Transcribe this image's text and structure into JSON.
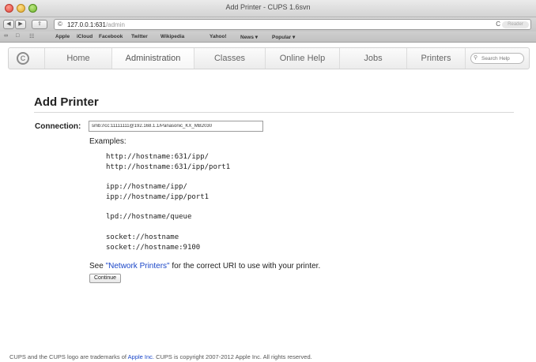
{
  "window": {
    "title": "Add Printer - CUPS 1.6svn"
  },
  "toolbar": {
    "back_icon": "◀",
    "forward_icon": "▶",
    "share_icon": "⇪",
    "url_icon": "©",
    "url_host": "127.0.0.1:631",
    "url_path": "/admin",
    "reload_icon": "C",
    "reader_label": "Reader"
  },
  "bookmarks": {
    "icons": [
      "∞",
      "□",
      "☷"
    ],
    "items": [
      "Apple",
      "iCloud",
      "Facebook",
      "Twitter",
      "Wikipedia",
      "Yahoo!",
      "News ▾",
      "Popular ▾"
    ]
  },
  "nav": {
    "logo": "C",
    "tabs": [
      "Home",
      "Administration",
      "Classes",
      "Online Help",
      "Jobs",
      "Printers"
    ],
    "active_tab": "Administration",
    "search_placeholder": "Search Help",
    "search_icon": "⚲"
  },
  "content": {
    "title": "Add Printer",
    "connection_label": "Connection:",
    "connection_value": "smb://cc:11111111@192.168.1.1/Panasonic_KX_MB2030",
    "examples_label": "Examples:",
    "examples": [
      "http://hostname:631/ipp/",
      "http://hostname:631/ipp/port1",
      "ipp://hostname/ipp/",
      "ipp://hostname/ipp/port1",
      "lpd://hostname/queue",
      "socket://hostname",
      "socket://hostname:9100"
    ],
    "hint_before": "See ",
    "hint_link": "\"Network Printers\"",
    "hint_after": " for the correct URI to use with your printer.",
    "continue_label": "Continue"
  },
  "footer": {
    "text_before": "CUPS and the CUPS logo are trademarks of ",
    "link": "Apple Inc.",
    "text_after": " CUPS is copyright 2007-2012 Apple Inc. All rights reserved."
  }
}
